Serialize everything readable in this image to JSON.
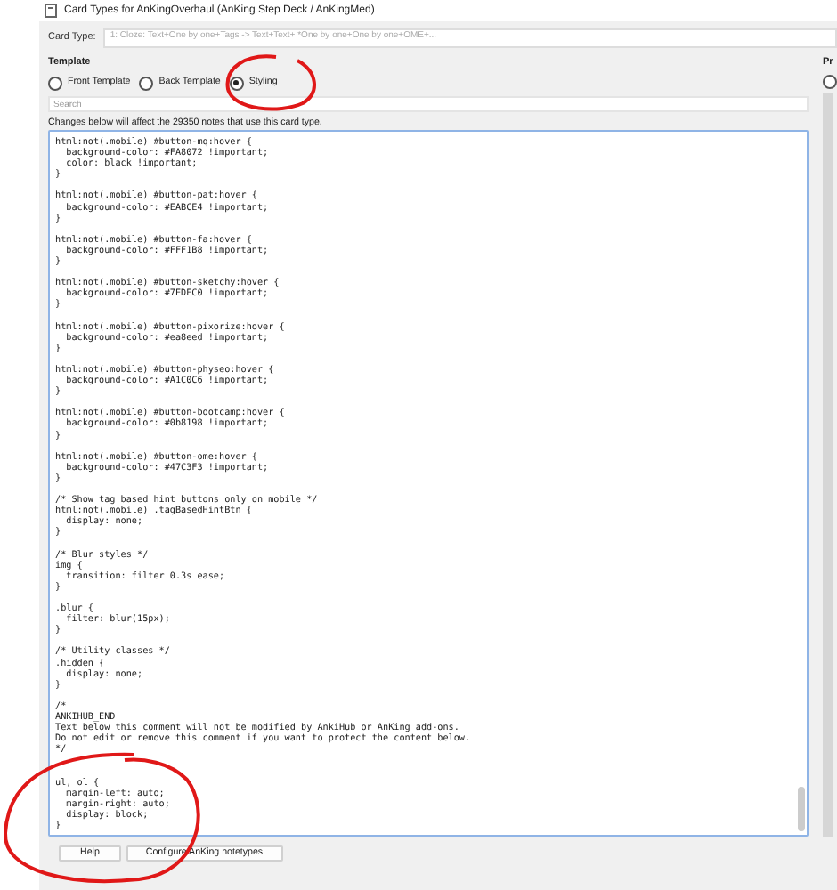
{
  "window": {
    "title": "Card Types for AnKingOverhaul (AnKing Step Deck / AnKingMed)"
  },
  "card_type": {
    "label": "Card Type:",
    "value": "1: Cloze: Text+One by one+Tags -> Text+Text+ *One by one+One by one+OME+..."
  },
  "template": {
    "heading": "Template",
    "options": [
      {
        "label": "Front Template",
        "selected": false
      },
      {
        "label": "Back Template",
        "selected": false
      },
      {
        "label": "Styling",
        "selected": true
      }
    ],
    "search": {
      "placeholder": "Search"
    },
    "notice": "Changes below will affect the 29350 notes that use this card type.",
    "code": "html:not(.mobile) #button-mq:hover {\n  background-color: #FA8072 !important;\n  color: black !important;\n}\n\nhtml:not(.mobile) #button-pat:hover {\n  background-color: #EABCE4 !important;\n}\n\nhtml:not(.mobile) #button-fa:hover {\n  background-color: #FFF1B8 !important;\n}\n\nhtml:not(.mobile) #button-sketchy:hover {\n  background-color: #7EDEC0 !important;\n}\n\nhtml:not(.mobile) #button-pixorize:hover {\n  background-color: #ea8eed !important;\n}\n\nhtml:not(.mobile) #button-physeo:hover {\n  background-color: #A1C0C6 !important;\n}\n\nhtml:not(.mobile) #button-bootcamp:hover {\n  background-color: #0b8198 !important;\n}\n\nhtml:not(.mobile) #button-ome:hover {\n  background-color: #47C3F3 !important;\n}\n\n/* Show tag based hint buttons only on mobile */\nhtml:not(.mobile) .tagBasedHintBtn {\n  display: none;\n}\n\n/* Blur styles */\nimg {\n  transition: filter 0.3s ease;\n}\n\n.blur {\n  filter: blur(15px);\n}\n\n/* Utility classes */\n.hidden {\n  display: none;\n}\n\n/*\nANKIHUB_END\nText below this comment will not be modified by AnkiHub or AnKing add-ons.\nDo not edit or remove this comment if you want to protect the content below.\n*/\n\n\nul, ol {\n  margin-left: auto;\n  margin-right: auto;\n  display: block;\n}"
  },
  "preview": {
    "heading": "Pr",
    "option": {
      "selected": false
    }
  },
  "buttons": [
    "Help",
    "Configure AnKing notetypes"
  ]
}
